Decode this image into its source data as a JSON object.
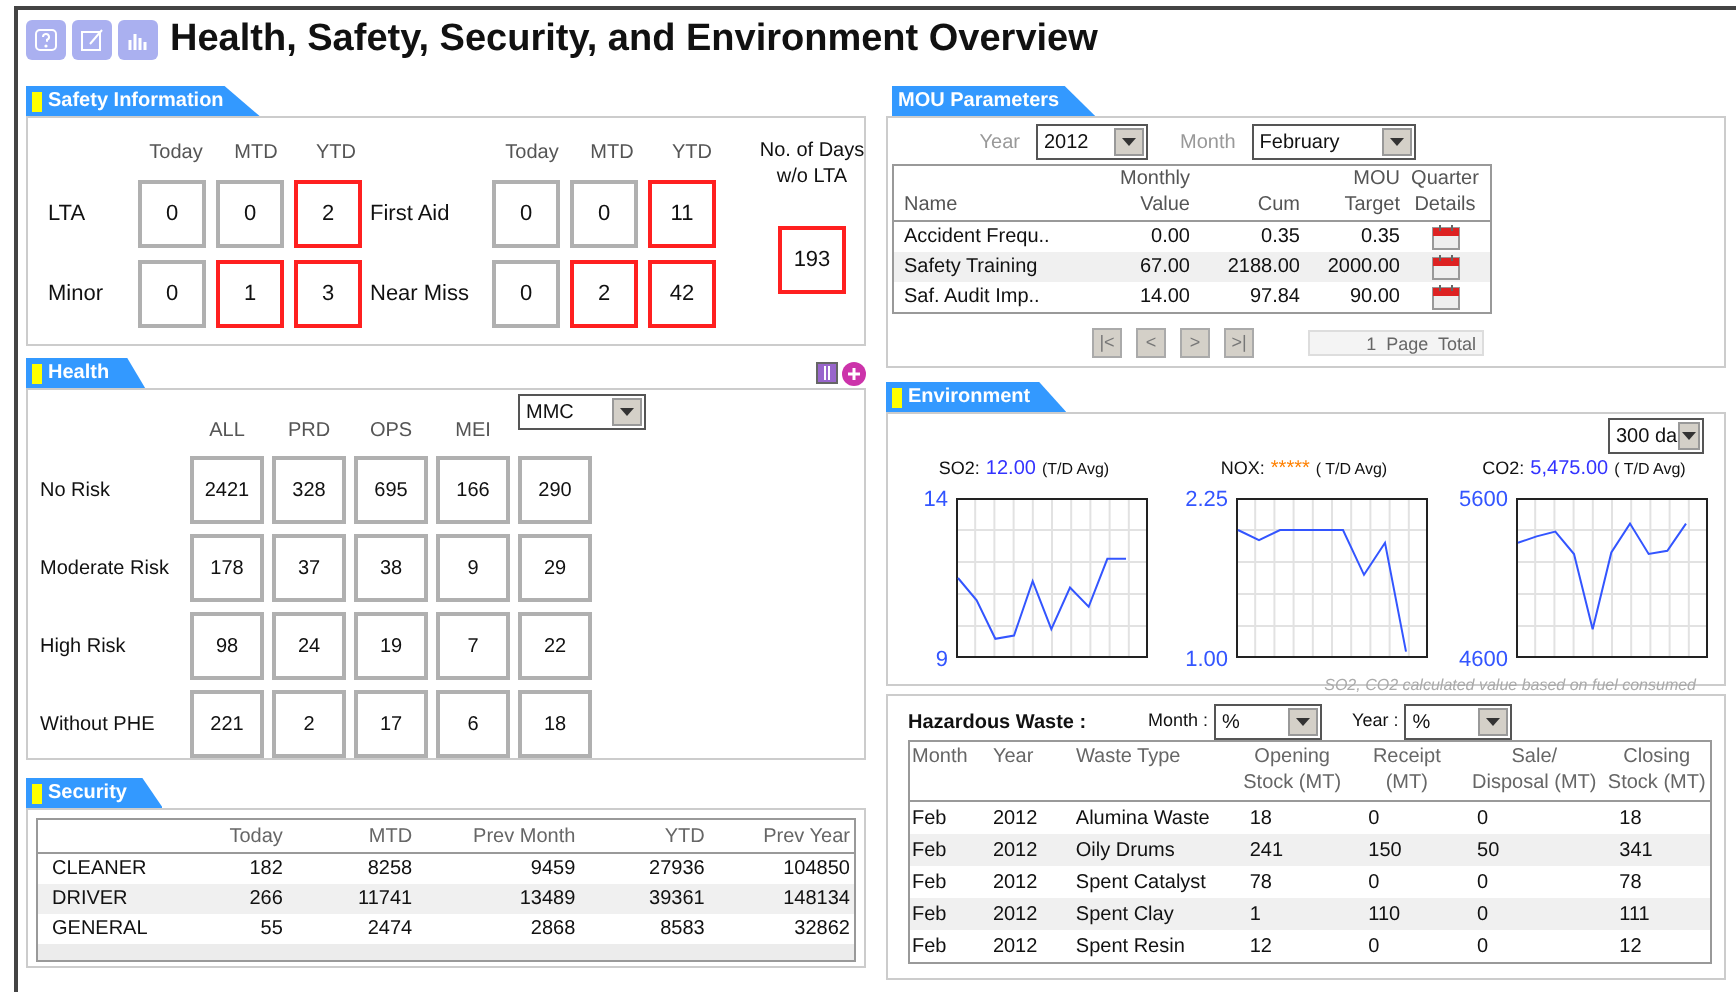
{
  "title": "Health, Safety, Security, and Environment Overview",
  "safety": {
    "tab": {
      "label": "Safety Information",
      "marker": true
    },
    "headers": [
      "Today",
      "MTD",
      "YTD",
      "Today",
      "MTD",
      "YTD"
    ],
    "days_label": "No. of Days w/o LTA",
    "days": {
      "value": "193",
      "alert": true
    },
    "rows": [
      {
        "groups": [
          {
            "label": "LTA",
            "cells": [
              {
                "value": "0",
                "alert": false
              },
              {
                "value": "0",
                "alert": false
              },
              {
                "value": "2",
                "alert": true
              }
            ]
          },
          {
            "label": "First Aid",
            "cells": [
              {
                "value": "0",
                "alert": false
              },
              {
                "value": "0",
                "alert": false
              },
              {
                "value": "11",
                "alert": true
              }
            ]
          }
        ]
      },
      {
        "groups": [
          {
            "label": "Minor",
            "cells": [
              {
                "value": "0",
                "alert": false
              },
              {
                "value": "1",
                "alert": true
              },
              {
                "value": "3",
                "alert": true
              }
            ]
          },
          {
            "label": "Near Miss",
            "cells": [
              {
                "value": "0",
                "alert": false
              },
              {
                "value": "2",
                "alert": true
              },
              {
                "value": "42",
                "alert": true
              }
            ]
          }
        ]
      }
    ]
  },
  "health": {
    "tab": {
      "label": "Health",
      "marker": true
    },
    "headers": [
      "ALL",
      "PRD",
      "OPS",
      "MEI"
    ],
    "select": "MMC",
    "rows": [
      {
        "label": "No Risk",
        "values": [
          "2421",
          "328",
          "695",
          "166",
          "290"
        ]
      },
      {
        "label": "Moderate Risk",
        "values": [
          "178",
          "37",
          "38",
          "9",
          "29"
        ]
      },
      {
        "label": "High Risk",
        "values": [
          "98",
          "24",
          "19",
          "7",
          "22"
        ]
      },
      {
        "label": "Without PHE",
        "values": [
          "221",
          "2",
          "17",
          "6",
          "18"
        ]
      }
    ]
  },
  "security": {
    "tab": {
      "label": "Security",
      "marker": true
    },
    "columns": [
      "Today",
      "MTD",
      "Prev Month",
      "YTD",
      "Prev Year"
    ],
    "rows": [
      {
        "name": "CLEANER",
        "values": [
          "182",
          "8258",
          "9459",
          "27936",
          "104850"
        ]
      },
      {
        "name": "DRIVER",
        "values": [
          "266",
          "11741",
          "13489",
          "39361",
          "148134"
        ]
      },
      {
        "name": "GENERAL",
        "values": [
          "55",
          "2474",
          "2868",
          "8583",
          "32862"
        ]
      }
    ]
  },
  "mou": {
    "tab": {
      "label": "MOU Parameters",
      "marker": false
    },
    "year_label": "Year",
    "year": "2012",
    "month_label": "Month",
    "month": "February",
    "columns": [
      {
        "lines": [
          "Name"
        ]
      },
      {
        "lines": [
          "Monthly",
          "Value"
        ]
      },
      {
        "lines": [
          "Cum"
        ]
      },
      {
        "lines": [
          "MOU",
          "Target"
        ]
      },
      {
        "lines": [
          "Quarter",
          "Details"
        ]
      }
    ],
    "rows": [
      {
        "name": "Accident Frequ..",
        "monthly": "0.00",
        "cum": "0.35",
        "target": "0.35"
      },
      {
        "name": "Safety Training",
        "monthly": "67.00",
        "cum": "2188.00",
        "target": "2000.00"
      },
      {
        "name": "Saf. Audit Imp..",
        "monthly": "14.00",
        "cum": "97.84",
        "target": "90.00"
      }
    ],
    "pager": [
      "|<",
      "<",
      ">",
      ">|"
    ],
    "page_info": "1  Page  Total"
  },
  "environment": {
    "tab": {
      "label": "Environment",
      "marker": true
    },
    "range_select": "300 da",
    "charts": [
      {
        "label": "SO2:",
        "value": "12.00",
        "available": true,
        "unit": "(T/D Avg)",
        "chart_data": {
          "type": "line",
          "grid": true,
          "ylim": [
            9,
            14
          ],
          "yticks": [
            9,
            14
          ],
          "series": [
            {
              "color": "#3355ff",
              "values": [
                11.5,
                10.8,
                9.6,
                9.7,
                11.4,
                9.9,
                11.2,
                10.6,
                12.1,
                12.1
              ]
            }
          ]
        }
      },
      {
        "label": "NOX:",
        "value": "*****",
        "available": false,
        "unit": "( T/D Avg)",
        "chart_data": {
          "type": "line",
          "grid": true,
          "ylim": [
            1.0,
            2.25
          ],
          "yticks": [
            {
              "value": 1.0,
              "label": "1.00"
            },
            {
              "value": 2.25,
              "label": "2.25"
            }
          ],
          "series": [
            {
              "color": "#3355ff",
              "values": [
                2.0,
                1.92,
                2.0,
                2.0,
                2.0,
                2.0,
                1.65,
                1.9,
                1.05
              ]
            }
          ]
        }
      },
      {
        "label": "CO2:",
        "value": "5,475.00",
        "available": true,
        "unit": "( T/D Avg)",
        "chart_data": {
          "type": "line",
          "grid": true,
          "ylim": [
            4600,
            5600
          ],
          "yticks": [
            4600,
            5600
          ],
          "series": [
            {
              "color": "#3355ff",
              "values": [
                5320,
                5360,
                5390,
                5250,
                4780,
                5260,
                5440,
                5250,
                5270,
                5440
              ]
            }
          ]
        }
      }
    ],
    "footnote": "SO2, CO2 calculated value based on fuel consumed"
  },
  "waste": {
    "title": "Hazardous Waste :",
    "month_label": "Month :",
    "month": "%",
    "year_label": "Year :",
    "year": "%",
    "columns": [
      {
        "lines": [
          "Month"
        ]
      },
      {
        "lines": [
          "Year"
        ]
      },
      {
        "lines": [
          "Waste Type"
        ]
      },
      {
        "lines": [
          "Opening",
          "Stock (MT)"
        ]
      },
      {
        "lines": [
          "Receipt",
          "(MT)"
        ]
      },
      {
        "lines": [
          "Sale/",
          "Disposal (MT)"
        ]
      },
      {
        "lines": [
          "Closing",
          "Stock (MT)"
        ]
      }
    ],
    "rows": [
      [
        "Feb",
        "2012",
        "Alumina Waste",
        "18",
        "0",
        "0",
        "18"
      ],
      [
        "Feb",
        "2012",
        "Oily Drums",
        "241",
        "150",
        "50",
        "341"
      ],
      [
        "Feb",
        "2012",
        "Spent Catalyst",
        "78",
        "0",
        "0",
        "78"
      ],
      [
        "Feb",
        "2012",
        "Spent Clay",
        "1",
        "110",
        "0",
        "111"
      ],
      [
        "Feb",
        "2012",
        "Spent Resin",
        "12",
        "0",
        "0",
        "12"
      ]
    ]
  }
}
